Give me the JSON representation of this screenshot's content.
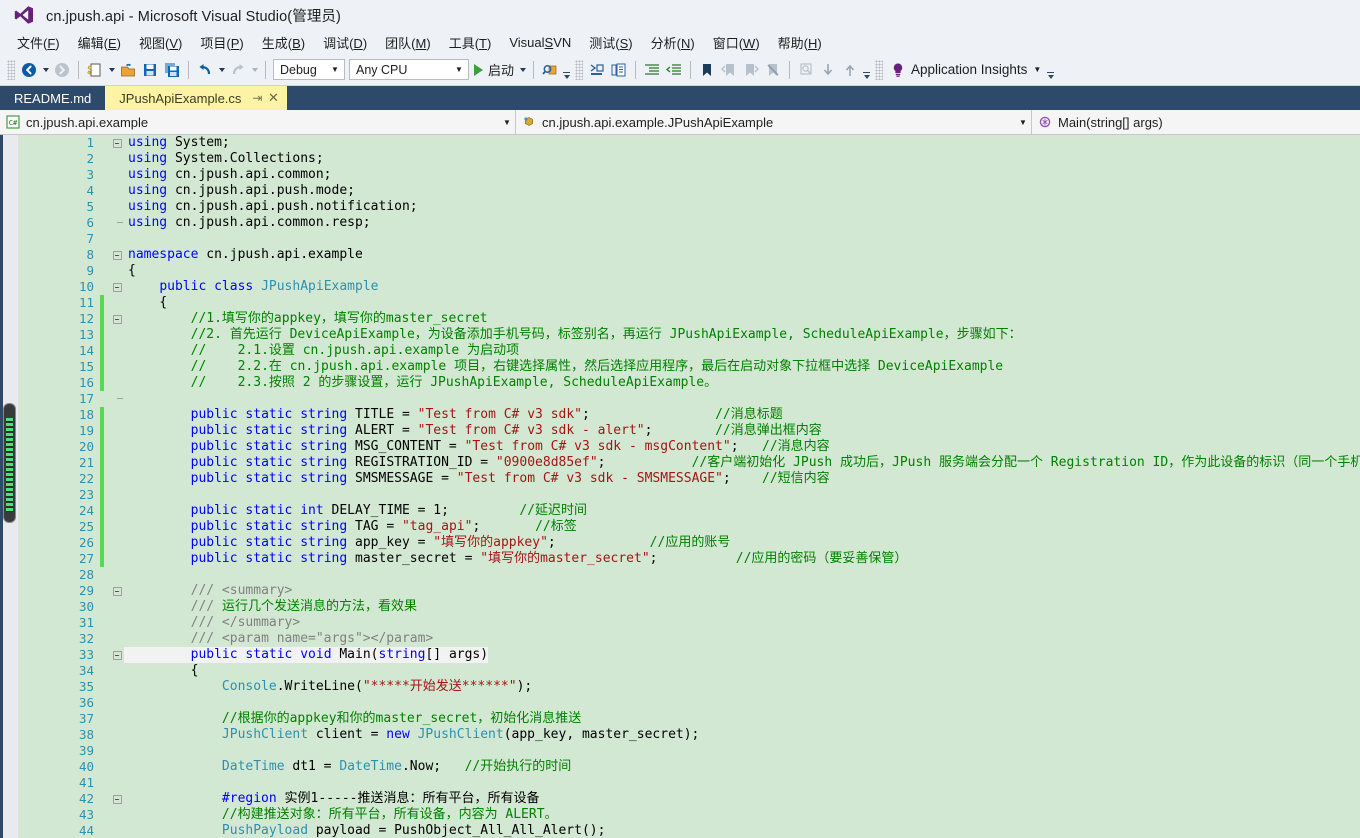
{
  "window": {
    "title": "cn.jpush.api - Microsoft Visual Studio(管理员)",
    "logo_name": "visual-studio-logo"
  },
  "menubar": {
    "items": [
      {
        "label": "文件(F)"
      },
      {
        "label": "编辑(E)"
      },
      {
        "label": "视图(V)"
      },
      {
        "label": "项目(P)"
      },
      {
        "label": "生成(B)"
      },
      {
        "label": "调试(D)"
      },
      {
        "label": "团队(M)"
      },
      {
        "label": "工具(T)"
      },
      {
        "label": "VisualSVN"
      },
      {
        "label": "测试(S)"
      },
      {
        "label": "分析(N)"
      },
      {
        "label": "窗口(W)"
      },
      {
        "label": "帮助(H)"
      }
    ]
  },
  "toolbar": {
    "navigate_back": "navigate-back-icon",
    "navigate_forward": "navigate-forward-icon",
    "new_project": "new-project-icon",
    "open_file": "open-file-icon",
    "save": "save-icon",
    "save_all": "save-all-icon",
    "undo": "undo-icon",
    "redo": "redo-icon",
    "config": "Debug",
    "platform": "Any CPU",
    "start_label": "启动",
    "find_icon": "find-in-files-icon",
    "app_insights_label": "Application Insights"
  },
  "tabs": [
    {
      "label": "README.md",
      "active": false
    },
    {
      "label": "JPushApiExample.cs",
      "active": true,
      "pin": "⇥",
      "close": "✕"
    }
  ],
  "navbar": {
    "namespace": "cn.jpush.api.example",
    "class": "cn.jpush.api.example.JPushApiExample",
    "member": "Main(string[] args)"
  },
  "editor": {
    "background": "#d3e8d3",
    "current_line": 33,
    "lines": [
      {
        "n": 1,
        "changed": false,
        "fold": "minus",
        "html": "<span class='kw'>using</span> <span class='pln'>System;</span>"
      },
      {
        "n": 2,
        "changed": false,
        "fold": "line",
        "html": "<span class='kw'>using</span> <span class='pln'>System.Collections;</span>"
      },
      {
        "n": 3,
        "changed": false,
        "fold": "line",
        "html": "<span class='kw'>using</span> <span class='pln'>cn.jpush.api.common;</span>"
      },
      {
        "n": 4,
        "changed": false,
        "fold": "line",
        "html": "<span class='kw'>using</span> <span class='pln'>cn.jpush.api.push.mode;</span>"
      },
      {
        "n": 5,
        "changed": false,
        "fold": "line",
        "html": "<span class='kw'>using</span> <span class='pln'>cn.jpush.api.push.notification;</span>"
      },
      {
        "n": 6,
        "changed": false,
        "fold": "lineend",
        "html": "<span class='kw'>using</span> <span class='pln'>cn.jpush.api.common.resp;</span>"
      },
      {
        "n": 7,
        "changed": false,
        "fold": "none",
        "html": ""
      },
      {
        "n": 8,
        "changed": false,
        "fold": "minus",
        "html": "<span class='kw'>namespace</span> <span class='pln'>cn.jpush.api.example</span>"
      },
      {
        "n": 9,
        "changed": false,
        "fold": "line",
        "html": "<span class='pln'>{</span>"
      },
      {
        "n": 10,
        "changed": false,
        "fold": "minus2",
        "html": "    <span class='kw'>public</span> <span class='kw'>class</span> <span class='typ'>JPushApiExample</span>"
      },
      {
        "n": 11,
        "changed": true,
        "fold": "line",
        "html": "    <span class='pln'>{</span>"
      },
      {
        "n": 12,
        "changed": true,
        "fold": "minus2",
        "html": "        <span class='cmt'>//1.填写你的appkey，填写你的master_secret</span>"
      },
      {
        "n": 13,
        "changed": true,
        "fold": "line",
        "html": "        <span class='cmt'>//2. 首先运行 DeviceApiExample，为设备添加手机号码，标签别名，再运行 JPushApiExample, ScheduleApiExample，步骤如下：</span>"
      },
      {
        "n": 14,
        "changed": true,
        "fold": "line",
        "html": "        <span class='cmt'>//    2.1.设置 cn.jpush.api.example 为启动项</span>"
      },
      {
        "n": 15,
        "changed": true,
        "fold": "line",
        "html": "        <span class='cmt'>//    2.2.在 cn.jpush.api.example 项目，右键选择属性，然后选择应用程序，最后在启动对象下拉框中选择 DeviceApiExample</span>"
      },
      {
        "n": 16,
        "changed": true,
        "fold": "line",
        "html": "        <span class='cmt'>//    2.3.按照 2 的步骤设置，运行 JPushApiExample, ScheduleApiExample。</span>"
      },
      {
        "n": 17,
        "changed": false,
        "fold": "lineend",
        "html": ""
      },
      {
        "n": 18,
        "changed": true,
        "fold": "line",
        "html": "        <span class='kw'>public</span> <span class='kw'>static</span> <span class='kw'>string</span> <span class='pln'>TITLE = </span><span class='str'>\"Test from C# v3 sdk\"</span><span class='pln'>;</span>                <span class='cmt'>//消息标题</span>"
      },
      {
        "n": 19,
        "changed": true,
        "fold": "line",
        "html": "        <span class='kw'>public</span> <span class='kw'>static</span> <span class='kw'>string</span> <span class='pln'>ALERT = </span><span class='str'>\"Test from C# v3 sdk - alert\"</span><span class='pln'>;</span>        <span class='cmt'>//消息弹出框内容</span>"
      },
      {
        "n": 20,
        "changed": true,
        "fold": "line",
        "html": "        <span class='kw'>public</span> <span class='kw'>static</span> <span class='kw'>string</span> <span class='pln'>MSG_CONTENT = </span><span class='str'>\"Test from C# v3 sdk - msgContent\"</span><span class='pln'>;</span>   <span class='cmt'>//消息内容</span>"
      },
      {
        "n": 21,
        "changed": true,
        "fold": "line",
        "html": "        <span class='kw'>public</span> <span class='kw'>static</span> <span class='kw'>string</span> <span class='pln'>REGISTRATION_ID = </span><span class='str'>\"0900e8d85ef\"</span><span class='pln'>;</span>           <span class='cmt'>//客户端初始化 JPush 成功后，JPush 服务端会分配一个 Registration ID，作为此设备的标识（同一个手机</span>"
      },
      {
        "n": 22,
        "changed": true,
        "fold": "line",
        "html": "        <span class='kw'>public</span> <span class='kw'>static</span> <span class='kw'>string</span> <span class='pln'>SMSMESSAGE = </span><span class='str'>\"Test from C# v3 sdk - SMSMESSAGE\"</span><span class='pln'>;</span>    <span class='cmt'>//短信内容</span>"
      },
      {
        "n": 23,
        "changed": true,
        "fold": "line",
        "html": ""
      },
      {
        "n": 24,
        "changed": true,
        "fold": "line",
        "html": "        <span class='kw'>public</span> <span class='kw'>static</span> <span class='kw'>int</span> <span class='pln'>DELAY_TIME = 1;</span>         <span class='cmt'>//延迟时间</span>"
      },
      {
        "n": 25,
        "changed": true,
        "fold": "line",
        "html": "        <span class='kw'>public</span> <span class='kw'>static</span> <span class='kw'>string</span> <span class='pln'>TAG = </span><span class='str'>\"tag_api\"</span><span class='pln'>;</span>       <span class='cmt'>//标签</span>"
      },
      {
        "n": 26,
        "changed": true,
        "fold": "line",
        "html": "        <span class='kw'>public</span> <span class='kw'>static</span> <span class='kw'>string</span> <span class='pln'>app_key = </span><span class='str'>\"填写你的appkey\"</span><span class='pln'>;</span>            <span class='cmt'>//应用的账号</span>"
      },
      {
        "n": 27,
        "changed": true,
        "fold": "line",
        "html": "        <span class='kw'>public</span> <span class='kw'>static</span> <span class='kw'>string</span> <span class='pln'>master_secret = </span><span class='str'>\"填写你的master_secret\"</span><span class='pln'>;</span>          <span class='cmt'>//应用的密码（要妥善保管）</span>"
      },
      {
        "n": 28,
        "changed": false,
        "fold": "line",
        "html": ""
      },
      {
        "n": 29,
        "changed": false,
        "fold": "minus2",
        "html": "        <span class='doc'>/// &lt;summary&gt;</span>"
      },
      {
        "n": 30,
        "changed": false,
        "fold": "line",
        "html": "        <span class='doc'>/// </span><span class='cmt'>运行几个发送消息的方法，看效果</span>"
      },
      {
        "n": 31,
        "changed": false,
        "fold": "line",
        "html": "        <span class='doc'>/// &lt;/summary&gt;</span>"
      },
      {
        "n": 32,
        "changed": false,
        "fold": "line",
        "html": "        <span class='doc'>/// &lt;param name=\"args\"&gt;&lt;/param&gt;</span>"
      },
      {
        "n": 33,
        "changed": false,
        "fold": "minus2",
        "html": "        <span class='kw'>public</span> <span class='kw'>static</span> <span class='kw'>void</span> <span class='pln'>Main(</span><span class='kw'>string</span><span class='pln'>[] args)</span>"
      },
      {
        "n": 34,
        "changed": false,
        "fold": "line",
        "html": "        <span class='pln'>{</span>"
      },
      {
        "n": 35,
        "changed": false,
        "fold": "line",
        "html": "            <span class='typ'>Console</span><span class='pln'>.WriteLine(</span><span class='str'>\"*****开始发送******\"</span><span class='pln'>);</span>"
      },
      {
        "n": 36,
        "changed": false,
        "fold": "line",
        "html": ""
      },
      {
        "n": 37,
        "changed": false,
        "fold": "line",
        "html": "            <span class='cmt'>//根据你的appkey和你的master_secret，初始化消息推送</span>"
      },
      {
        "n": 38,
        "changed": false,
        "fold": "line",
        "html": "            <span class='typ'>JPushClient</span> <span class='pln'>client = </span><span class='kw'>new</span> <span class='typ'>JPushClient</span><span class='pln'>(app_key, master_secret);</span>"
      },
      {
        "n": 39,
        "changed": false,
        "fold": "line",
        "html": ""
      },
      {
        "n": 40,
        "changed": false,
        "fold": "line",
        "html": "            <span class='typ'>DateTime</span> <span class='pln'>dt1 = </span><span class='typ'>DateTime</span><span class='pln'>.Now;   </span><span class='cmt'>//开始执行的时间</span>"
      },
      {
        "n": 41,
        "changed": false,
        "fold": "line",
        "html": ""
      },
      {
        "n": 42,
        "changed": false,
        "fold": "minus2",
        "html": "            <span class='pre'>#region</span> <span class='pln'>实例1-----推送消息：所有平台，所有设备</span>"
      },
      {
        "n": 43,
        "changed": false,
        "fold": "line",
        "html": "            <span class='cmt'>//构建推送对象：所有平台，所有设备，内容为 ALERT。</span>"
      },
      {
        "n": 44,
        "changed": false,
        "fold": "line",
        "html": "            <span class='typ'>PushPayload</span> <span class='pln'>payload = PushObject_All_All_Alert();</span>"
      }
    ]
  }
}
